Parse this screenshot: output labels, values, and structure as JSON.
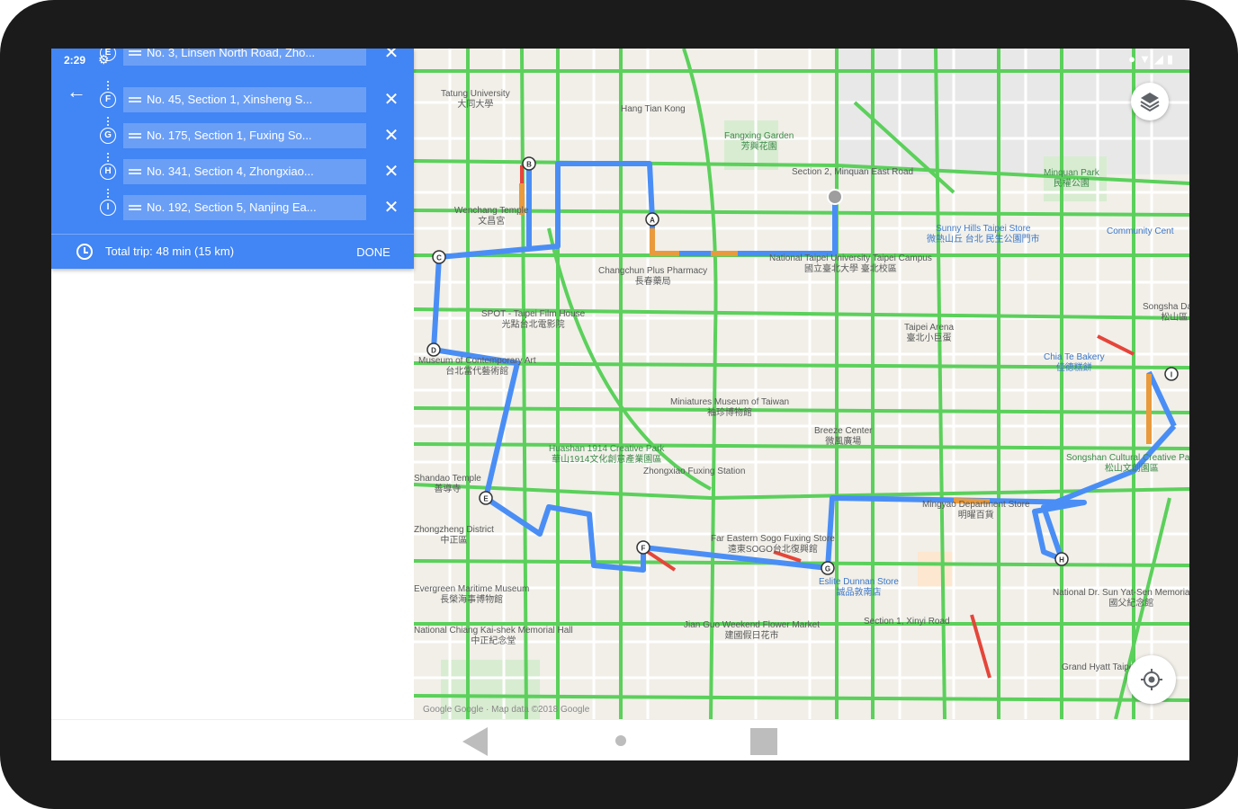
{
  "status_bar": {
    "time": "2:29",
    "settings_icon": "gear-icon",
    "right_icons": [
      "location-icon",
      "wifi-icon",
      "signal-icon",
      "battery-icon"
    ]
  },
  "directions": {
    "back_icon": "arrow-back-icon",
    "stops": [
      {
        "letter": "E",
        "address": "No. 3, Linsen North Road, Zho..."
      },
      {
        "letter": "F",
        "address": "No. 45, Section 1, Xinsheng S..."
      },
      {
        "letter": "G",
        "address": "No. 175, Section 1, Fuxing So..."
      },
      {
        "letter": "H",
        "address": "No. 341, Section 4, Zhongxiao..."
      },
      {
        "letter": "I",
        "address": "No. 192, Section 5, Nanjing Ea..."
      }
    ],
    "remove_icon": "close-icon",
    "total_trip": "Total trip: 48 min  (15 km)",
    "done_label": "DONE"
  },
  "map": {
    "attribution": "Google  Google · Map data ©2018 Google",
    "route_color": "#4a8ef5",
    "traffic_color": "#5bd05b",
    "layers_icon": "layers-icon",
    "locate_icon": "my-location-icon",
    "places": [
      {
        "name": "Tatung University",
        "sub": "大同大學"
      },
      {
        "name": "Hang Tian Kong",
        "sub": ""
      },
      {
        "name": "Fangxing Garden",
        "sub": "芳興花園"
      },
      {
        "name": "Section 2, Minquan East Road",
        "sub": ""
      },
      {
        "name": "Minquan Park",
        "sub": "民權公園"
      },
      {
        "name": "Wenchang Temple",
        "sub": "文昌宮"
      },
      {
        "name": "Sunny Hills Taipei Store",
        "sub": "微熱山丘 台北 民生公園門市"
      },
      {
        "name": "Community Cent",
        "sub": ""
      },
      {
        "name": "Changchun Plus Pharmacy",
        "sub": "長春藥局"
      },
      {
        "name": "National Taipei University Taipei Campus",
        "sub": "國立臺北大學 臺北校區"
      },
      {
        "name": "SPOT - Taipei Film House",
        "sub": "光點台北電影院"
      },
      {
        "name": "Taipei Arena",
        "sub": "臺北小巨蛋"
      },
      {
        "name": "Songsha Dajian",
        "sub": "松山區"
      },
      {
        "name": "Museum of Contemporary Art",
        "sub": "台北當代藝術館"
      },
      {
        "name": "Chia Te Bakery",
        "sub": "佳德糕餅"
      },
      {
        "name": "Miniatures Museum of Taiwan",
        "sub": "袖珍博物館"
      },
      {
        "name": "Breeze Center",
        "sub": "微風廣場"
      },
      {
        "name": "Huashan 1914 Creative Park",
        "sub": "華山1914文化創意產業園區"
      },
      {
        "name": "Zhongxiao Fuxing Station",
        "sub": ""
      },
      {
        "name": "Songshan Cultural Creative Park",
        "sub": "松山文創園區"
      },
      {
        "name": "Shandao Temple",
        "sub": "善導寺"
      },
      {
        "name": "Zhongzheng District",
        "sub": "中正區"
      },
      {
        "name": "Far Eastern Sogo Fuxing Store",
        "sub": "遠東SOGO台北復興館"
      },
      {
        "name": "Mingyao Department Store",
        "sub": "明曜百貨"
      },
      {
        "name": "Eslite Dunnan Store",
        "sub": "誠品敦南店"
      },
      {
        "name": "National Dr. Sun Yat-Sen Memorial Hall",
        "sub": "國父紀念館"
      },
      {
        "name": "Evergreen Maritime Museum",
        "sub": "長榮海事博物館"
      },
      {
        "name": "National Chiang Kai-shek Memorial Hall",
        "sub": "中正紀念堂"
      },
      {
        "name": "Jian Guo Weekend Flower Market",
        "sub": "建國假日花市"
      },
      {
        "name": "Grand Hyatt Taipei",
        "sub": ""
      },
      {
        "name": "Section 1, Xinyi Road",
        "sub": ""
      }
    ],
    "markers": [
      "A",
      "B",
      "C",
      "D",
      "E",
      "F",
      "G",
      "H",
      "I"
    ]
  },
  "navbar": {
    "back_icon": "nav-back-icon",
    "home_icon": "nav-home-icon",
    "recents_icon": "nav-recents-icon"
  }
}
